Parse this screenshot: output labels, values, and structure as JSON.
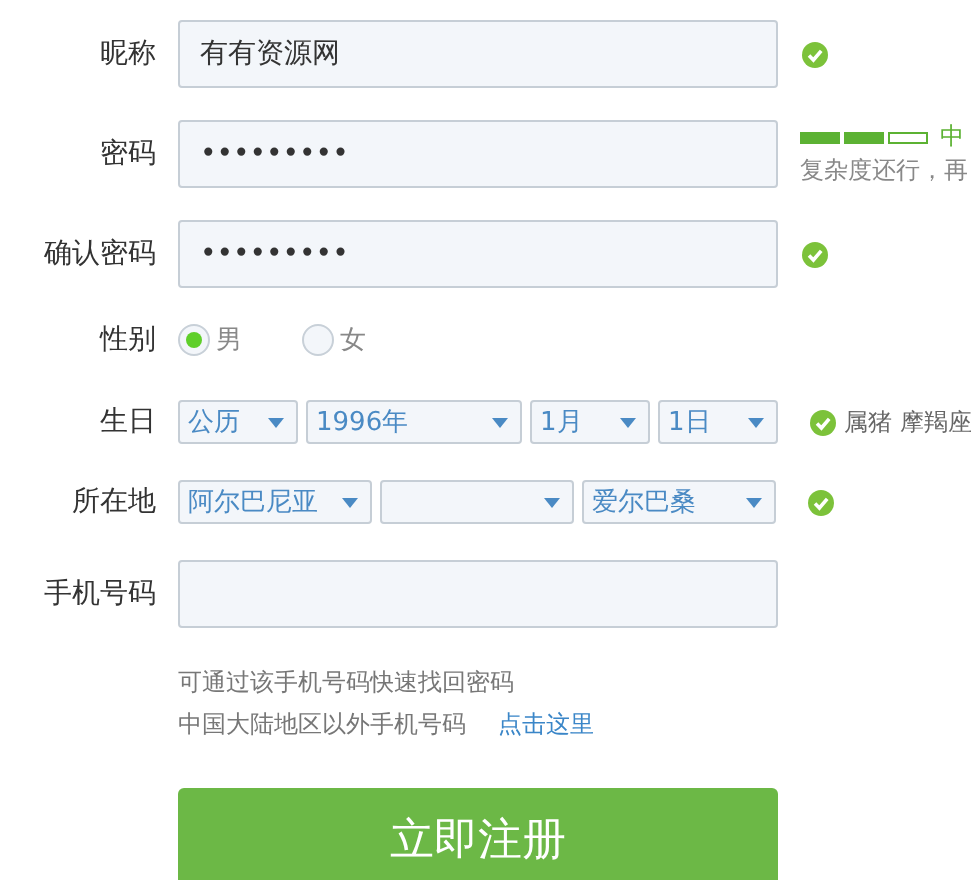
{
  "fields": [
    {
      "kind": "text",
      "label": "昵称",
      "value": "有有资源网",
      "valid": true
    },
    {
      "kind": "password",
      "label": "密码",
      "value": "•••••••••",
      "strength": {
        "segments": [
          {
            "on": true
          },
          {
            "on": true
          },
          {
            "on": false
          }
        ],
        "label": "中",
        "hint": "复杂度还行，再"
      }
    },
    {
      "kind": "password",
      "label": "确认密码",
      "value": "•••••••••",
      "valid": true
    },
    {
      "kind": "radio",
      "label": "性别",
      "options": [
        {
          "label": "男",
          "selected": true
        },
        {
          "label": "女",
          "selected": false
        }
      ]
    },
    {
      "kind": "selects",
      "label": "生日",
      "selects": [
        {
          "kind": "choice",
          "value": "公历"
        },
        {
          "kind": "choice",
          "value": "1996年"
        },
        {
          "kind": "choice",
          "value": "1月"
        },
        {
          "kind": "choice",
          "value": "1日"
        }
      ],
      "valid": true,
      "notes": [
        "属猪",
        "摩羯座"
      ]
    },
    {
      "kind": "selects",
      "label": "所在地",
      "selects": [
        {
          "kind": "choice",
          "value": "阿尔巴尼亚"
        },
        {
          "kind": "blank"
        },
        {
          "kind": "choice",
          "value": "爱尔巴桑"
        }
      ],
      "valid": true
    },
    {
      "kind": "text",
      "label": "手机号码",
      "valid": false
    }
  ],
  "phone_hints": [
    {
      "text": "可通过该手机号码快速找回密码"
    },
    {
      "text": "中国大陆地区以外手机号码",
      "link": "点击这里"
    }
  ],
  "submit": "立即注册"
}
